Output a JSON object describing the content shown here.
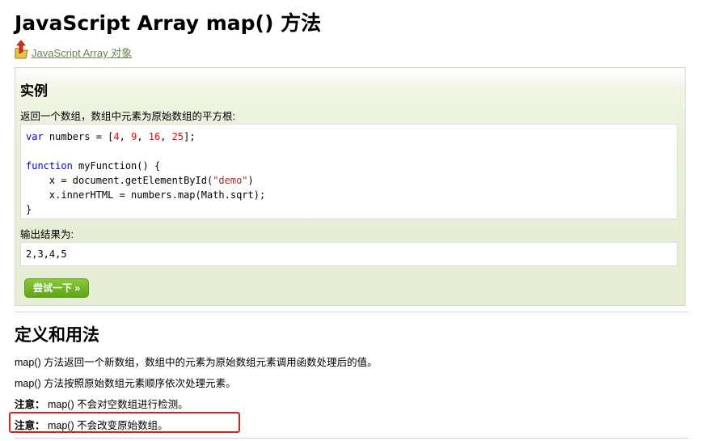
{
  "page": {
    "title": "JavaScript Array map() 方法",
    "back_link": "JavaScript Array 对象"
  },
  "example": {
    "heading": "实例",
    "description": "返回一个数组，数组中元素为原始数组的平方根:",
    "code": {
      "l1_kw": "var",
      "l1_rest_a": " numbers = [",
      "l1_n1": "4",
      "l1_sep1": ", ",
      "l1_n2": "9",
      "l1_sep2": ", ",
      "l1_n3": "16",
      "l1_sep3": ", ",
      "l1_n4": "25",
      "l1_end": "];",
      "l3_kw": "function",
      "l3_rest": " myFunction() {",
      "l4_a": "    x = document.getElementById(",
      "l4_str": "\"demo\"",
      "l4_b": ")",
      "l5": "    x.innerHTML = numbers.map(Math.sqrt);",
      "l6": "}"
    },
    "output_label": "输出结果为:",
    "output_value": "2,3,4,5",
    "try_button": "尝试一下 »"
  },
  "definition": {
    "heading": "定义和用法",
    "p1": "map() 方法返回一个新数组，数组中的元素为原始数组元素调用函数处理后的值。",
    "p2": "map() 方法按照原始数组元素顺序依次处理元素。",
    "note1_label": "注意：",
    "note1_text": " map() 不会对空数组进行检测。",
    "note2_label": "注意：",
    "note2_text": " map() 不会改变原始数组。"
  },
  "colors": {
    "link": "#64854c",
    "button": "#6cb220",
    "highlight": "#e02020",
    "example_bg": "#e7efd6"
  }
}
